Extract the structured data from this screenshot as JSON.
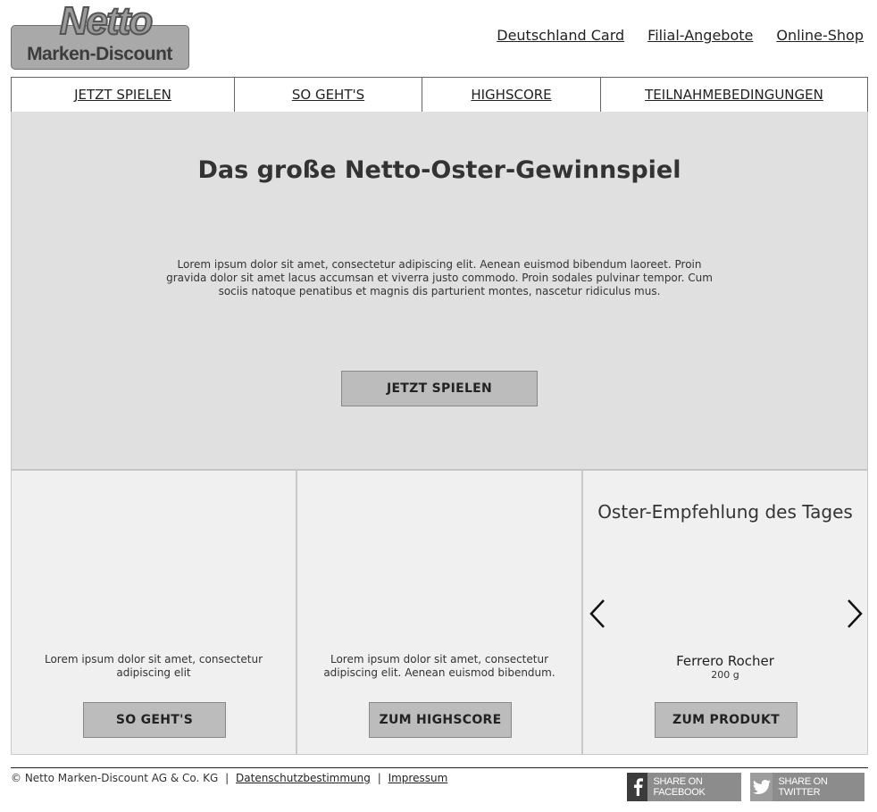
{
  "header": {
    "logo": {
      "line1": "Netto",
      "line2": "Marken-Discount"
    },
    "links": [
      "Deutschland Card",
      "Filial-Angebote",
      "Online-Shop"
    ]
  },
  "nav": {
    "tabs": [
      "JETZT SPIELEN",
      "SO GEHT'S",
      "HIGHSCORE",
      "TEILNAHMEBEDINGUNGEN"
    ]
  },
  "hero": {
    "title": "Das große Netto-Oster-Gewinnspiel",
    "text": "Lorem ipsum dolor sit amet, consectetur adipiscing elit. Aenean euismod bibendum laoreet. Proin gravida dolor sit amet lacus accumsan et viverra justo commodo. Proin sodales pulvinar tempor. Cum sociis natoque penatibus et magnis dis parturient montes, nascetur ridiculus mus.",
    "button": "JETZT SPIELEN"
  },
  "cards": {
    "howto": {
      "text": "Lorem ipsum dolor sit amet, consectetur adipiscing elit",
      "button": "SO GEHT'S"
    },
    "highscore": {
      "text": "Lorem ipsum dolor sit amet, consectetur adipiscing elit. Aenean euismod bibendum.",
      "button": "ZUM HIGHSCORE"
    },
    "recommendation": {
      "title": "Oster-Empfehlung des Tages",
      "product_name": "Ferrero Rocher",
      "product_weight": "200 g",
      "button": "ZUM PRODUKT",
      "prev_icon": "chevron-left-icon",
      "next_icon": "chevron-right-icon"
    }
  },
  "footer": {
    "copyright": "© Netto Marken-Discount AG & Co. KG",
    "separator": "|",
    "privacy": "Datenschutzbestimmung",
    "imprint": "Impressum"
  },
  "share": {
    "facebook": {
      "label": "SHARE ON FACEBOOK",
      "icon": "facebook-icon"
    },
    "twitter": {
      "label": "SHARE ON TWITTER",
      "icon": "twitter-icon"
    }
  },
  "colors": {
    "hero_bg": "#e0e0e0",
    "card_bg": "#f0f0f0",
    "button_bg": "#bcbcbc",
    "share_bg": "#8c8c8c"
  }
}
